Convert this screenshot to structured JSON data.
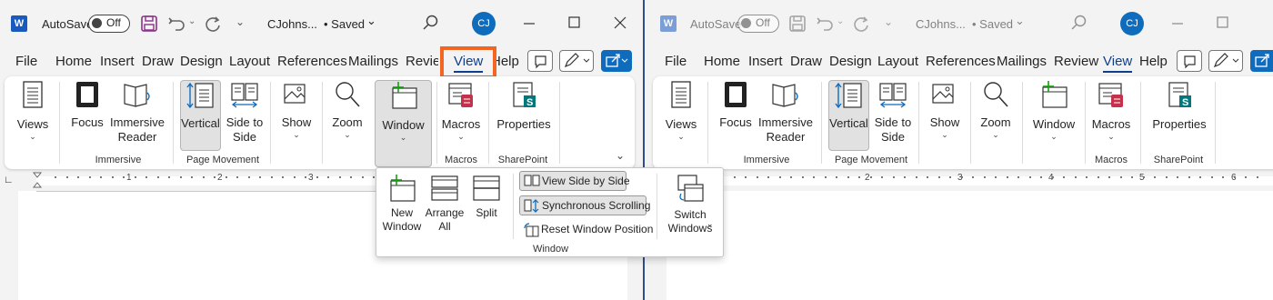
{
  "app": {
    "autosave_label": "AutoSave",
    "autosave_state": "Off",
    "doc_title": "CJohns...",
    "save_status": "• Saved",
    "save_status_chevron": "⌄",
    "user_initials": "CJ"
  },
  "tabs": [
    "File",
    "Home",
    "Insert",
    "Draw",
    "Design",
    "Layout",
    "References",
    "Mailings",
    "Review",
    "View",
    "Help"
  ],
  "active_tab": "View",
  "ribbon": {
    "views": "Views",
    "focus": "Focus",
    "immersive_reader": "Immersive Reader",
    "vertical": "Vertical",
    "side_to_side": "Side to Side",
    "show": "Show",
    "zoom": "Zoom",
    "window": "Window",
    "macros": "Macros",
    "properties": "Properties",
    "groups": {
      "immersive": "Immersive",
      "page_movement": "Page Movement",
      "macros": "Macros",
      "sharepoint": "SharePoint"
    }
  },
  "window_dropdown": {
    "new_window": "New Window",
    "arrange_all": "Arrange All",
    "split": "Split",
    "view_side_by_side": "View Side by Side",
    "synchronous_scrolling": "Synchronous Scrolling",
    "reset_window_position": "Reset Window Position",
    "switch_windows": "Switch Windows",
    "group_label": "Window"
  },
  "ruler_numbers": [
    "1",
    "2",
    "3",
    "4",
    "5",
    "6"
  ],
  "colors": {
    "accent_blue": "#0f6cbd",
    "highlight_orange": "#f26522",
    "word_blue": "#185abd",
    "sharepoint_green": "#03787c",
    "macro_red": "#c4314b"
  }
}
